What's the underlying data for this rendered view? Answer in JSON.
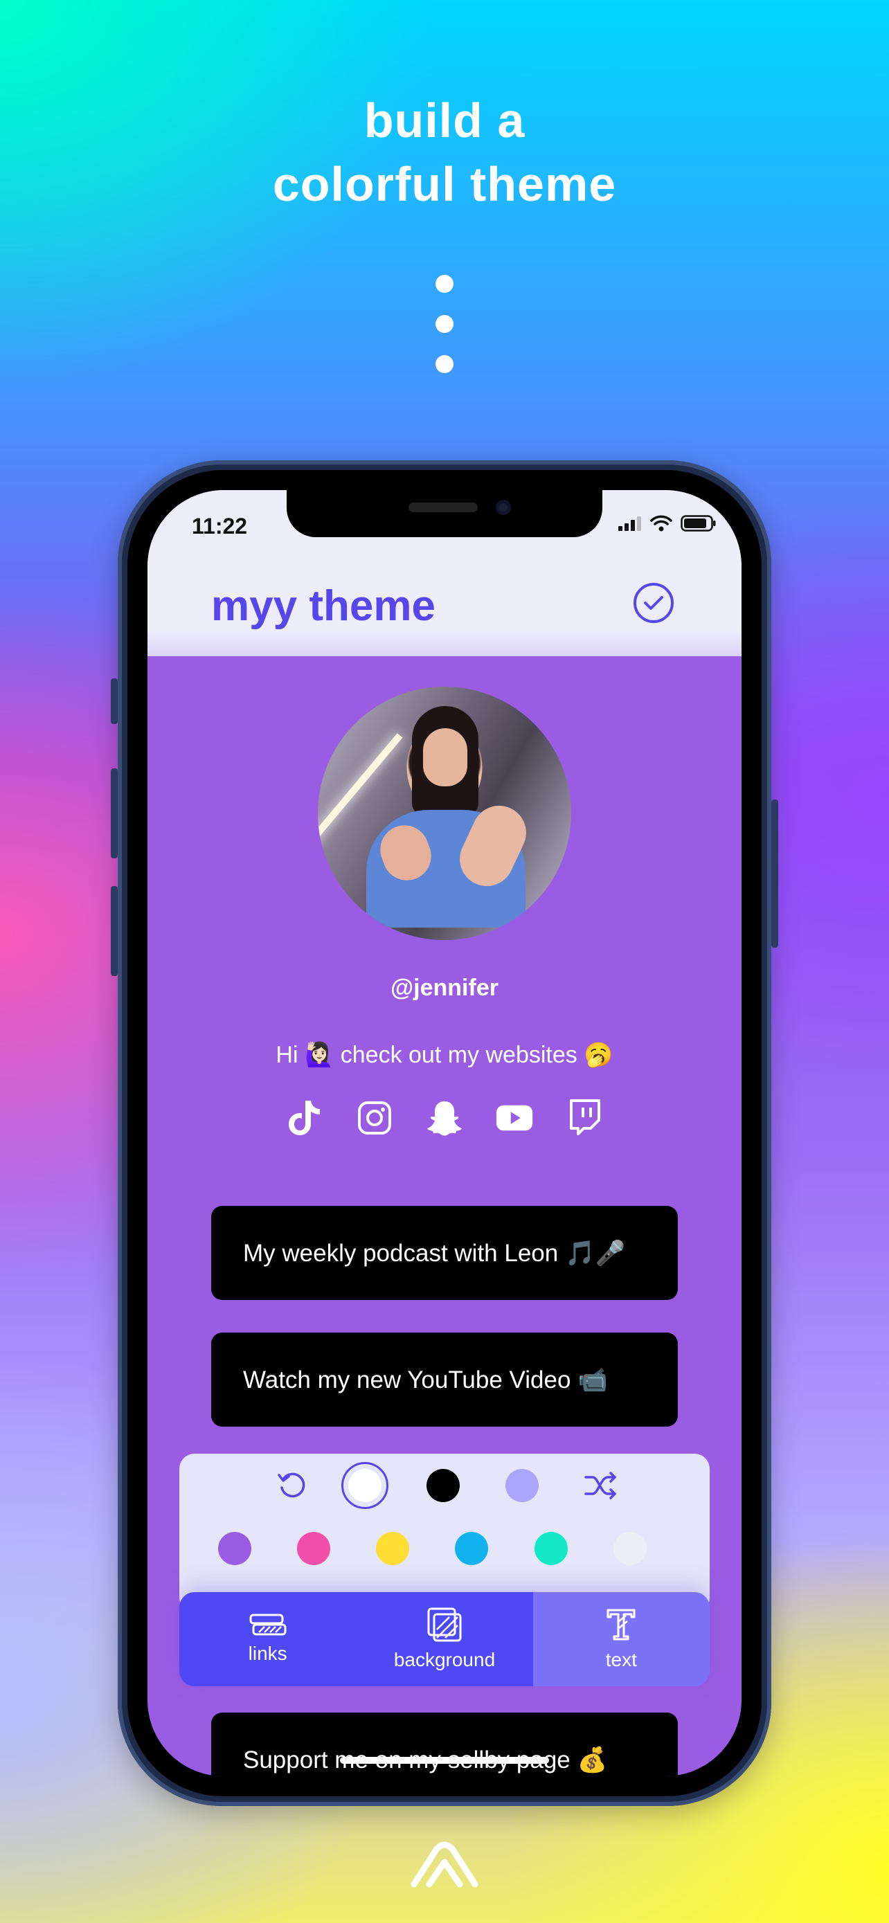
{
  "headline": {
    "line1": "build a",
    "line2": "colorful theme"
  },
  "status_bar": {
    "time": "11:22"
  },
  "header": {
    "title": "myy theme"
  },
  "profile": {
    "username": "@jennifer",
    "bio": "Hi 🙋🏻‍♀️ check out my websites 🥱"
  },
  "socials": [
    "tiktok-icon",
    "instagram-icon",
    "snapchat-icon",
    "youtube-icon",
    "twitch-icon"
  ],
  "links": [
    {
      "label": "My weekly podcast with Leon 🎵🎤"
    },
    {
      "label": "Watch my new YouTube Video 📹"
    },
    {
      "label": "Support me on my sellby page 💰"
    }
  ],
  "palette": {
    "row1": [
      {
        "kind": "reset",
        "icon": "undo-icon"
      },
      {
        "kind": "color",
        "color": "#ffffff",
        "selected": true
      },
      {
        "kind": "color",
        "color": "#000000"
      },
      {
        "kind": "color",
        "color": "#aaa6fb"
      },
      {
        "kind": "shuffle",
        "icon": "shuffle-icon"
      }
    ],
    "row2": [
      "#9a5ce3",
      "#f250a8",
      "#ffdd33",
      "#12b2ee",
      "#14e9c5",
      "#ededf5"
    ]
  },
  "tabs": [
    {
      "label": "links",
      "icon": "links-icon",
      "active": false
    },
    {
      "label": "background",
      "icon": "background-icon",
      "active": false
    },
    {
      "label": "text",
      "icon": "text-icon",
      "active": true
    }
  ],
  "colors": {
    "accent": "#5747ea",
    "background": "#9a5ce3",
    "tab": "#4e49f5",
    "tab_active": "#7b72f8"
  }
}
